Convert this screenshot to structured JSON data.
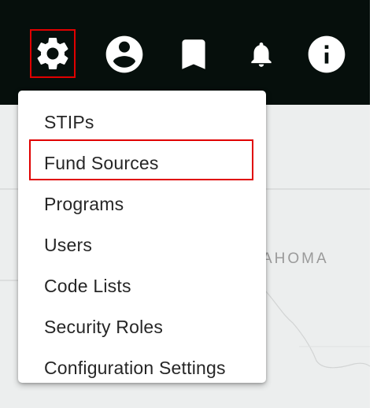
{
  "header": {
    "icons": [
      {
        "name": "settings",
        "icon": "gear-icon"
      },
      {
        "name": "account",
        "icon": "account-circle-icon"
      },
      {
        "name": "bookmark",
        "icon": "bookmark-icon"
      },
      {
        "name": "notifications",
        "icon": "bell-icon"
      },
      {
        "name": "info",
        "icon": "info-icon"
      }
    ]
  },
  "menu": {
    "items": [
      {
        "label": "STIPs"
      },
      {
        "label": "Fund Sources"
      },
      {
        "label": "Programs"
      },
      {
        "label": "Users"
      },
      {
        "label": "Code Lists"
      },
      {
        "label": "Security Roles"
      },
      {
        "label": "Configuration Settings"
      }
    ],
    "highlighted": "Fund Sources"
  },
  "map": {
    "label": "AHOMA"
  },
  "colors": {
    "topbar": "#060f0c",
    "icon": "#ffffff",
    "highlight_border": "#e00000",
    "menu_text": "#262626",
    "map_background": "#eceeee"
  }
}
